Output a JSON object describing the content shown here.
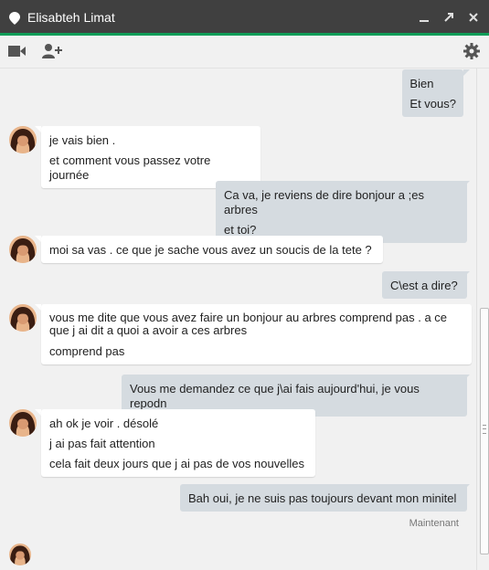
{
  "window": {
    "title": "Elisabteh Limat"
  },
  "icons": {
    "title": "location-pin-icon",
    "minimize": "minimize-icon",
    "popout": "popout-icon",
    "close": "close-icon",
    "video": "video-camera-icon",
    "add_person": "add-person-icon",
    "settings": "gear-icon"
  },
  "colors": {
    "titlebar": "#404040",
    "accent": "#0f9d58",
    "outgoing_bubble": "#d5dbe0",
    "incoming_bubble": "#ffffff",
    "chat_background": "#f1f1f1"
  },
  "messages": [
    {
      "from": "me",
      "lines": [
        "Bien",
        "Et vous?"
      ]
    },
    {
      "from": "contact",
      "lines": [
        "je vais bien .",
        "et comment vous passez votre journée"
      ]
    },
    {
      "from": "me",
      "lines": [
        "Ca va, je reviens de dire bonjour a ;es arbres",
        "et toi?"
      ]
    },
    {
      "from": "contact",
      "lines": [
        "moi sa vas . ce que je sache vous avez un soucis de la tete ?"
      ]
    },
    {
      "from": "me",
      "lines": [
        "C\\est a dire?"
      ]
    },
    {
      "from": "contact",
      "lines": [
        "vous me dite que vous avez faire un bonjour au arbres comprend pas . a ce",
        "que j ai dit a quoi a avoir a ces arbres",
        "comprend pas"
      ]
    },
    {
      "from": "me",
      "lines": [
        "Vous me demandez ce que j\\ai fais aujourd'hui, je vous repodn"
      ]
    },
    {
      "from": "contact",
      "lines": [
        "ah ok je voir . désolé",
        "j ai pas fait attention",
        "cela fait deux jours que j ai pas de vos nouvelles"
      ]
    },
    {
      "from": "me",
      "lines": [
        "Bah oui, je ne suis pas toujours devant mon minitel"
      ]
    }
  ],
  "timestamp": "Maintenant"
}
